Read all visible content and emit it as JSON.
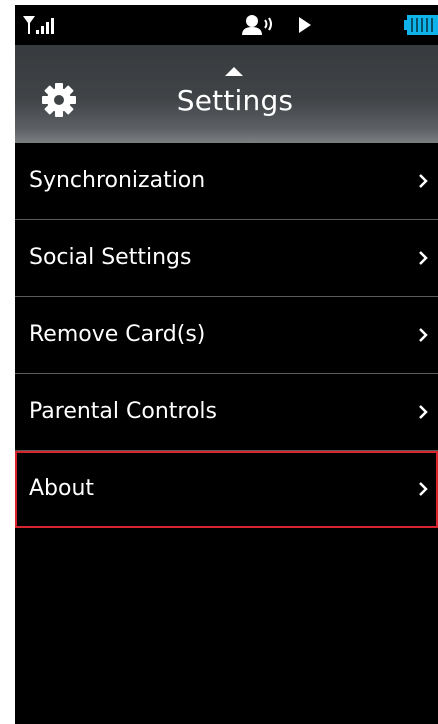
{
  "status_bar": {
    "icons": [
      "signal-strength-icon",
      "headset-icon",
      "play-icon",
      "battery-icon"
    ]
  },
  "header": {
    "title": "Settings",
    "icon": "gear-icon"
  },
  "menu": {
    "items": [
      {
        "label": "Synchronization",
        "chevron": "›"
      },
      {
        "label": "Social Settings",
        "chevron": "›"
      },
      {
        "label": "Remove Card(s)",
        "chevron": "›"
      },
      {
        "label": "Parental Controls",
        "chevron": "›"
      },
      {
        "label": "About",
        "chevron": "›",
        "selected": true
      }
    ]
  },
  "colors": {
    "background": "#000000",
    "text": "#ffffff",
    "selection_outline": "#d8242c",
    "battery": "#0db3ea"
  }
}
